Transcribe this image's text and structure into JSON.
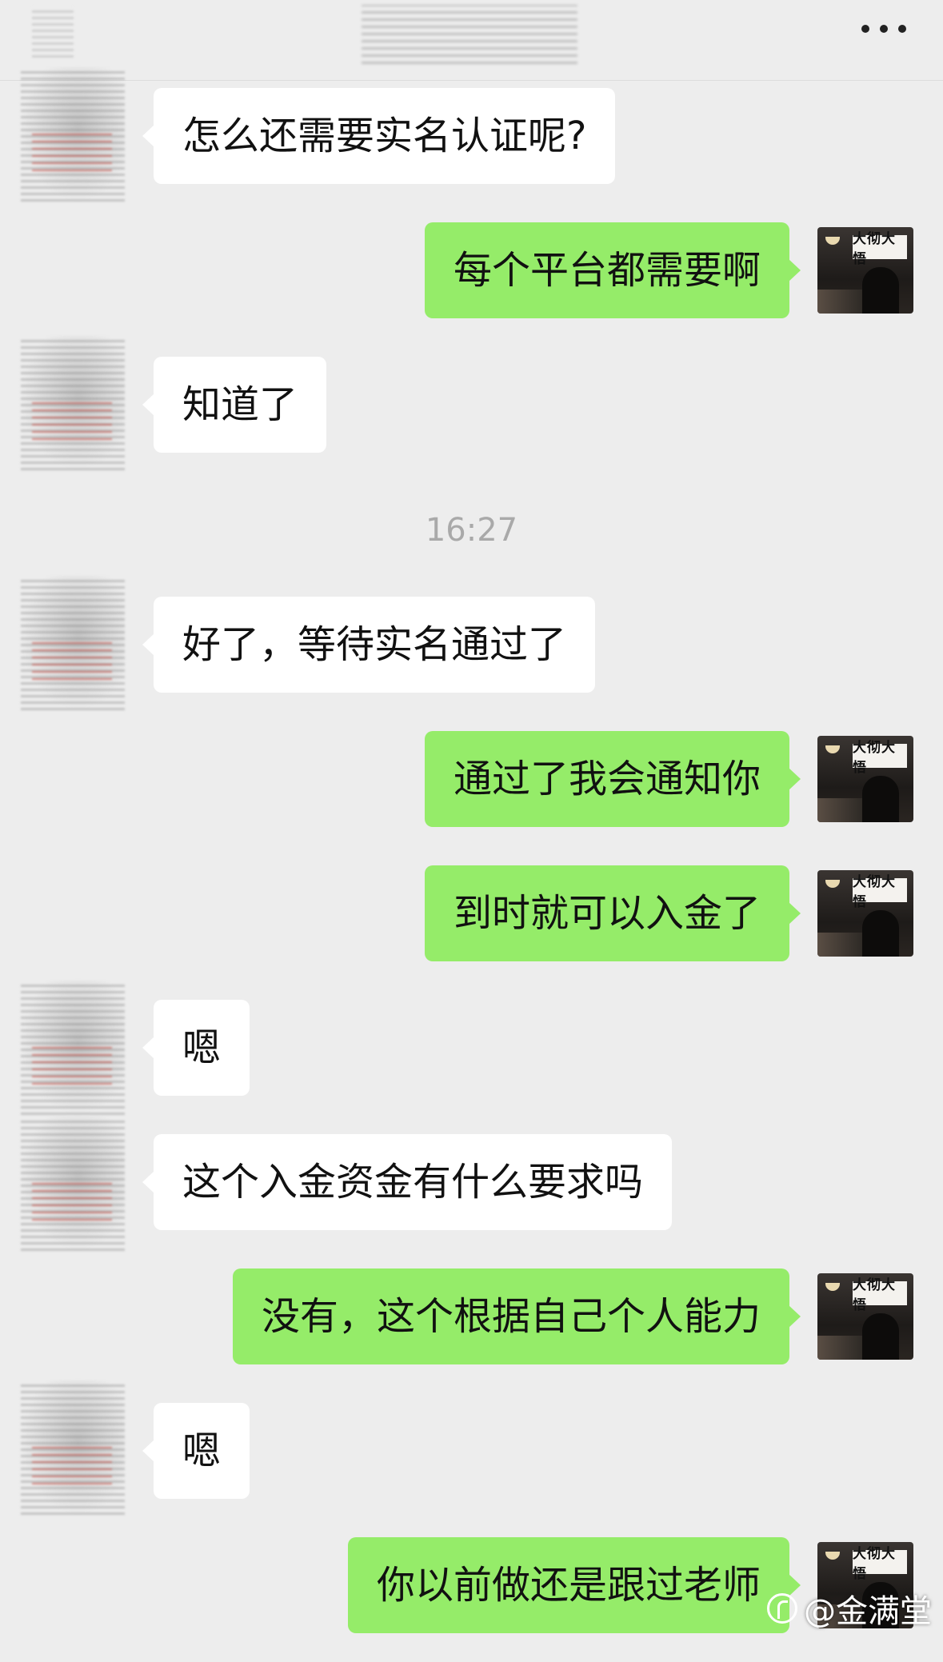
{
  "header": {
    "more_icon": "more-horizontal-icon"
  },
  "timestamp": "16:27",
  "avatar_right_sign": "大彻大悟",
  "messages": [
    {
      "side": "left",
      "text": "怎么还需要实名认证呢?"
    },
    {
      "side": "right",
      "text": "每个平台都需要啊"
    },
    {
      "side": "left",
      "text": "知道了"
    },
    {
      "side": "left",
      "text": "好了，等待实名通过了"
    },
    {
      "side": "right",
      "text": "通过了我会通知你"
    },
    {
      "side": "right",
      "text": "到时就可以入金了"
    },
    {
      "side": "left",
      "text": "嗯"
    },
    {
      "side": "left",
      "text": "这个入金资金有什么要求吗"
    },
    {
      "side": "right",
      "text": "没有，这个根据自己个人能力"
    },
    {
      "side": "left",
      "text": "嗯"
    },
    {
      "side": "right",
      "text": "你以前做还是跟过老师"
    }
  ],
  "watermark": "@金满堂",
  "colors": {
    "background": "#ededed",
    "bubble_self": "#95ec69",
    "bubble_other": "#ffffff",
    "timestamp": "#a9a9a9"
  }
}
